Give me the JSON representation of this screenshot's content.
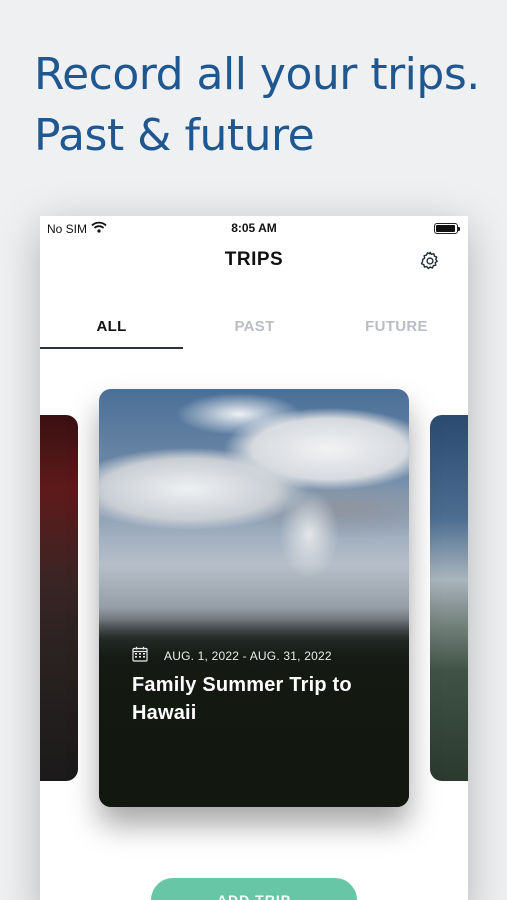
{
  "headline": {
    "line1": "Record all your trips.",
    "line2": "Past & future"
  },
  "status_bar": {
    "carrier": "No SIM",
    "time": "8:05 AM"
  },
  "nav": {
    "title": "TRIPS",
    "settings_icon": "gear-icon"
  },
  "tabs": [
    {
      "label": "ALL",
      "active": true
    },
    {
      "label": "PAST",
      "active": false
    },
    {
      "label": "FUTURE",
      "active": false
    }
  ],
  "trip_card": {
    "date_range": "AUG. 1, 2022 - AUG. 31, 2022",
    "title": "Family Summer Trip to Hawaii",
    "calendar_icon": "calendar-icon"
  },
  "add_button": {
    "label": "ADD TRIP"
  },
  "colors": {
    "headline": "#1f5791",
    "accent_button": "#67c6a5",
    "inactive_tab": "#b9bec4",
    "background": "#eef0f2"
  }
}
